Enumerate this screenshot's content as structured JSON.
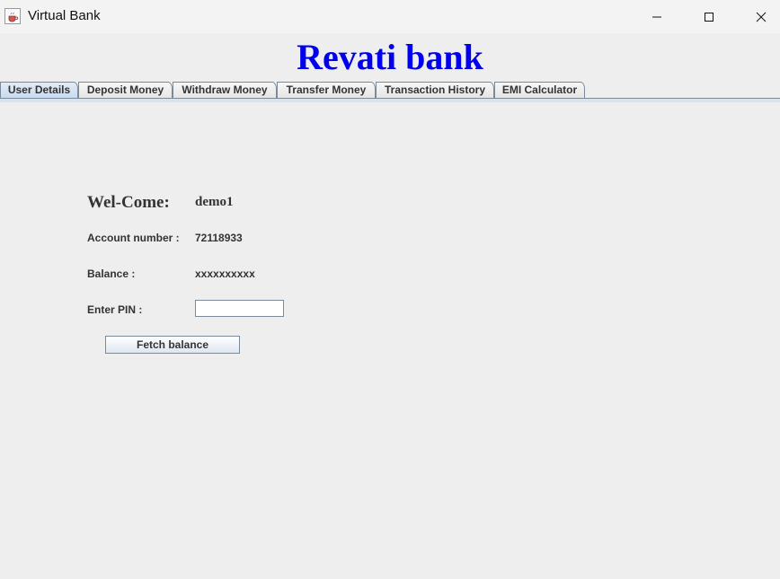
{
  "window": {
    "title": "Virtual Bank",
    "icon": "java-cup-icon"
  },
  "banner": {
    "title": "Revati bank",
    "color": "#0000ee"
  },
  "tabs": [
    {
      "label": "User Details",
      "active": true
    },
    {
      "label": "Deposit Money",
      "active": false
    },
    {
      "label": "Withdraw Money",
      "active": false
    },
    {
      "label": "Transfer Money",
      "active": false
    },
    {
      "label": "Transaction History",
      "active": false
    },
    {
      "label": "EMI Calculator",
      "active": false
    }
  ],
  "user_details": {
    "welcome_label": "Wel-Come:",
    "username": "demo1",
    "account_number_label": "Account number :",
    "account_number": "72118933",
    "balance_label": "Balance :",
    "balance": "xxxxxxxxxx",
    "pin_label": "Enter PIN :",
    "pin_value": "",
    "fetch_button": "Fetch balance"
  }
}
